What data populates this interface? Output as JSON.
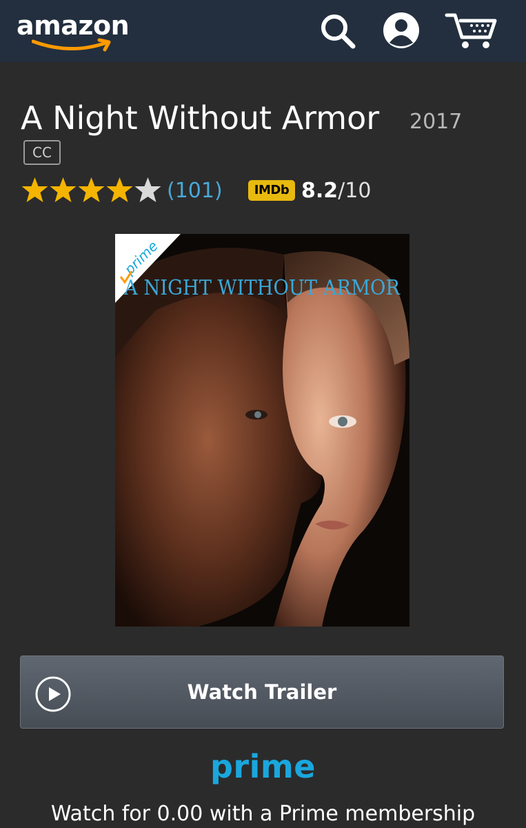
{
  "header": {
    "logo_text": "amazon",
    "icons": [
      "search-icon",
      "account-icon",
      "cart-icon"
    ]
  },
  "movie": {
    "title": "A Night Without Armor",
    "year": "2017",
    "cc_badge": "CC",
    "star_rating": 4,
    "star_max": 5,
    "rating_count": "(101)",
    "imdb_label": "IMDb",
    "imdb_score": "8.2",
    "imdb_max": "/10"
  },
  "poster": {
    "title_text": "A NIGHT WITHOUT ARMOR",
    "badge_text": "prime"
  },
  "actions": {
    "trailer_label": "Watch Trailer"
  },
  "prime": {
    "logo_text": "prime",
    "offer_text": "Watch for 0.00 with a Prime membership"
  },
  "colors": {
    "header_bg": "#232f3e",
    "page_bg": "#2b2b2b",
    "star": "#f4b400",
    "link": "#4aa8d8",
    "prime_blue": "#1aa7dd",
    "imdb_yellow": "#e8b90f"
  }
}
